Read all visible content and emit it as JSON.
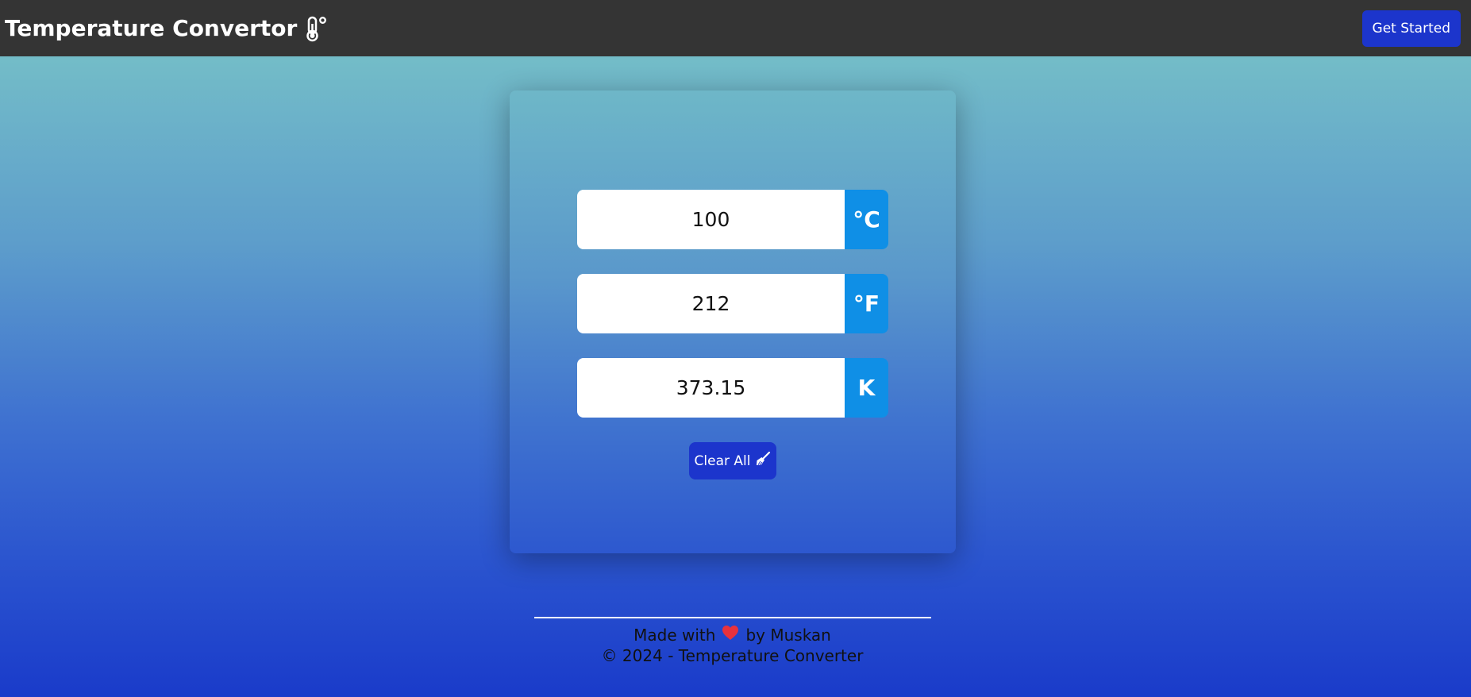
{
  "navbar": {
    "title": "Temperature Convertor",
    "title_icon": "thermometer-icon",
    "cta_label": "Get Started",
    "bg_color": "#343434",
    "cta_color": "#1c35cc"
  },
  "converter": {
    "fields": [
      {
        "value": "100",
        "unit": "°C"
      },
      {
        "value": "212",
        "unit": "°F"
      },
      {
        "value": "373.15",
        "unit": "K"
      }
    ],
    "unit_color": "#0f8fe6",
    "clear_label": "Clear All",
    "clear_icon": "broom-icon"
  },
  "footer": {
    "made_prefix": "Made with",
    "heart_icon": "heart-icon",
    "made_suffix": "by Muskan",
    "copyright": "© 2024 - Temperature Converter"
  }
}
